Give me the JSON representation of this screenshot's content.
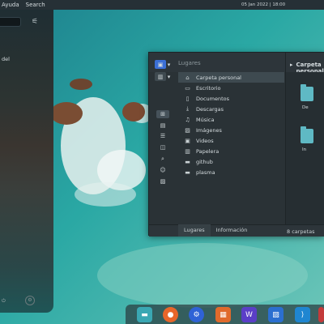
{
  "top_panel": {
    "menus": [
      "Ayuda",
      "Search"
    ],
    "clock": "05 Jan 2022 | 18:00"
  },
  "launcher": {
    "filter_icon": "sliders-icon",
    "app_text": "del"
  },
  "file_manager": {
    "places_header": "Lugares",
    "breadcrumb_current": "Carpeta personal",
    "breadcrumb_arrow": "▸",
    "places": [
      {
        "label": "Carpeta personal",
        "icon": "home-icon"
      },
      {
        "label": "Escritorio",
        "icon": "desktop-icon"
      },
      {
        "label": "Documentos",
        "icon": "document-icon"
      },
      {
        "label": "Descargas",
        "icon": "download-icon"
      },
      {
        "label": "Música",
        "icon": "music-icon"
      },
      {
        "label": "Imágenes",
        "icon": "image-icon"
      },
      {
        "label": "Videos",
        "icon": "video-icon"
      },
      {
        "label": "Papelera",
        "icon": "trash-icon"
      },
      {
        "label": "github",
        "icon": "folder-icon"
      },
      {
        "label": "plasma",
        "icon": "folder-icon"
      }
    ],
    "active_place_index": 0,
    "vertical_tabs": [
      "grid-icon",
      "tag-icon",
      "list-icon",
      "columns-icon",
      "search-icon",
      "emoji-icon",
      "image-icon"
    ],
    "content_folders": [
      {
        "label": "De"
      },
      {
        "label": "In"
      }
    ],
    "bottom_tabs": [
      "Lugares",
      "Información"
    ],
    "active_bottom_tab": 0,
    "status": "8 carpetas"
  },
  "dock": {
    "apps": [
      {
        "name": "file-manager-icon",
        "color": "#3aa7b3"
      },
      {
        "name": "firefox-icon",
        "color": "#e8662a"
      },
      {
        "name": "settings-icon",
        "color": "#2f62d6"
      },
      {
        "name": "app-grid-icon",
        "color": "#e06a2c"
      },
      {
        "name": "writer-icon",
        "color": "#5a3ec7"
      },
      {
        "name": "image-viewer-icon",
        "color": "#2b6fd0"
      },
      {
        "name": "vscode-icon",
        "color": "#1f86d1"
      },
      {
        "name": "terminal-icon",
        "color": "#c43a3a"
      }
    ]
  },
  "colors": {
    "panel": "#263036",
    "accent": "#5fb9c4",
    "selection": "#3e4a50"
  }
}
